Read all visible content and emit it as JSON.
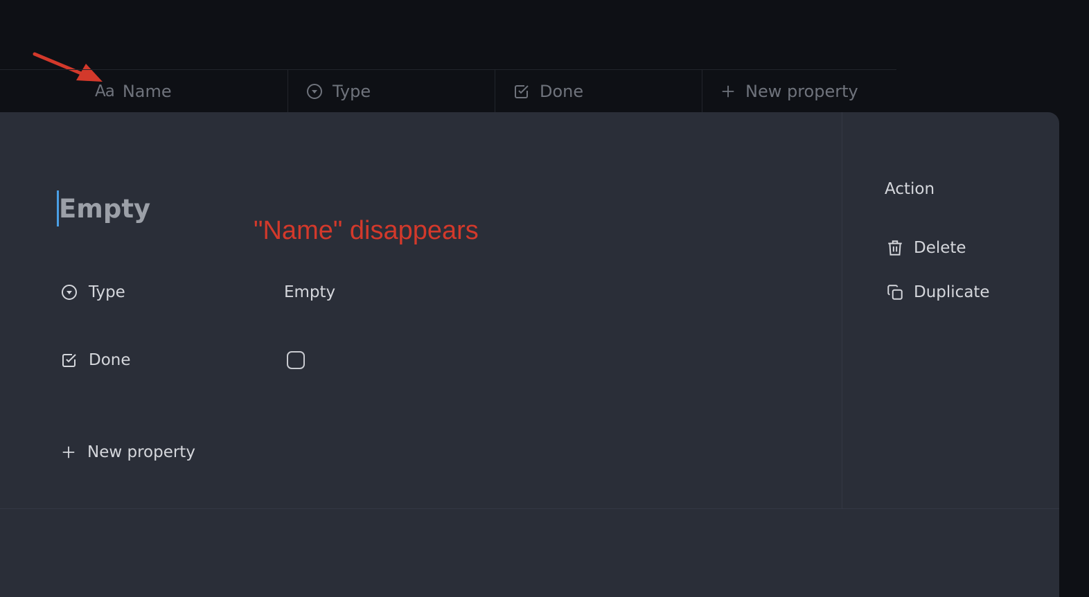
{
  "table_header": {
    "columns": [
      {
        "label": "Name",
        "icon": "text-aa-icon",
        "icon_text": "Aa"
      },
      {
        "label": "Type",
        "icon": "select-circle-icon"
      },
      {
        "label": "Done",
        "icon": "checkbox-icon"
      },
      {
        "label": "New property",
        "icon": "plus-icon"
      }
    ]
  },
  "annotation": {
    "text": "\"Name\" disappears",
    "color": "#d3392b"
  },
  "record": {
    "title_placeholder": "Empty",
    "properties": [
      {
        "label": "Type",
        "icon": "select-circle-icon",
        "value": "Empty"
      },
      {
        "label": "Done",
        "icon": "checkbox-icon",
        "checked": false
      }
    ],
    "new_property_label": "New property"
  },
  "actions": {
    "title": "Action",
    "items": [
      {
        "label": "Delete",
        "icon": "trash-icon"
      },
      {
        "label": "Duplicate",
        "icon": "duplicate-icon"
      }
    ]
  },
  "colors": {
    "background": "#0e1015",
    "panel": "#2a2e38",
    "caret": "#4a9fe6",
    "annotation": "#d3392b"
  }
}
